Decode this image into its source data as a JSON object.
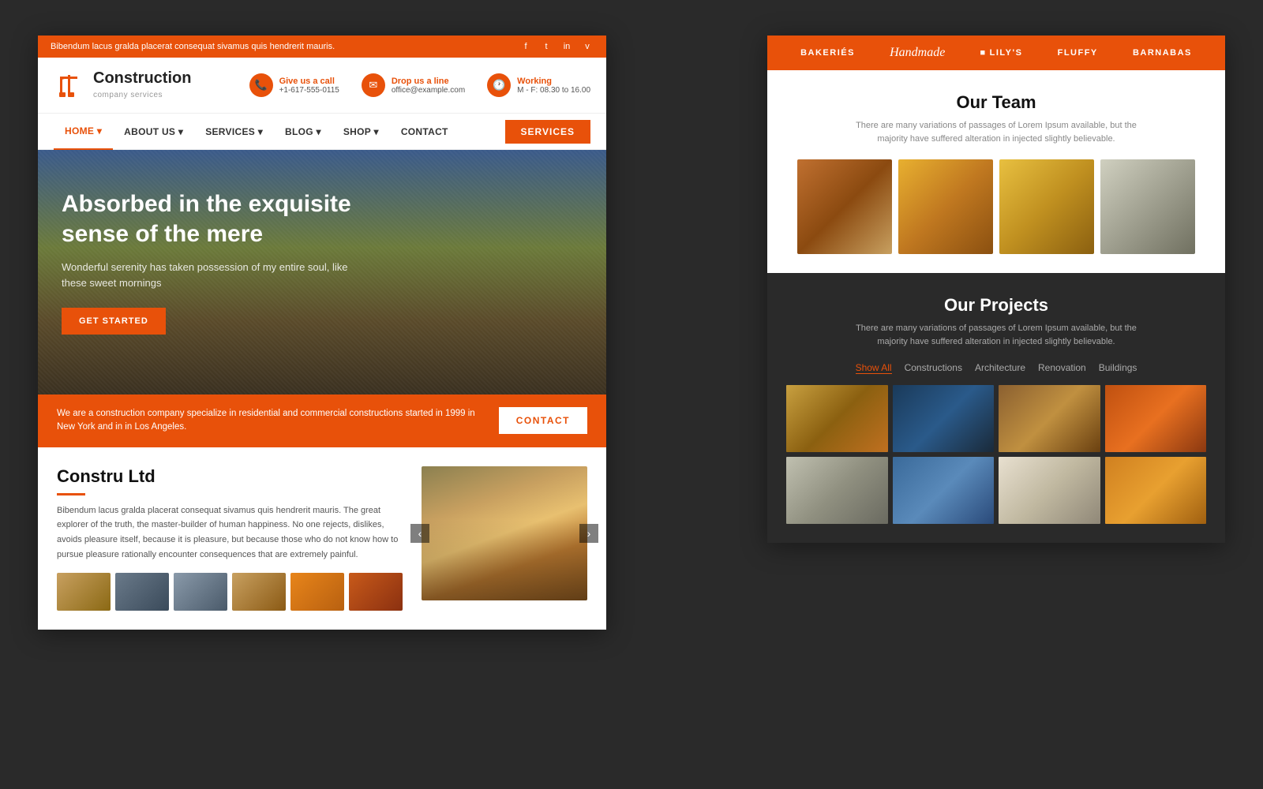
{
  "topbar": {
    "message": "Bibendum lacus gralda placerat consequat sivamus quis hendrerit mauris.",
    "social": [
      "f",
      "t",
      "in",
      "v"
    ]
  },
  "header": {
    "logo_company": "Construction",
    "logo_subtitle": "company services",
    "call_label": "Give us a call",
    "call_number": "+1-617-555-0115",
    "email_label": "Drop us a line",
    "email_address": "office@example.com",
    "hours_label": "Working",
    "hours_value": "M - F: 08.30 to 16.00"
  },
  "nav": {
    "items": [
      "HOME",
      "ABOUT US",
      "SERVICES",
      "BLOG",
      "SHOP",
      "CONTACT"
    ],
    "cta": "SERVICES"
  },
  "hero": {
    "title": "Absorbed in the exquisite sense of the mere",
    "subtitle": "Wonderful serenity has taken possession of my entire soul, like these sweet mornings",
    "cta": "GET STARTED"
  },
  "cta_banner": {
    "text": "We are a construction company specialize in residential and commercial constructions  started in 1999 in New York and in in Los Angeles.",
    "button": "CONTACT"
  },
  "about": {
    "title": "Constru Ltd",
    "description": "Bibendum lacus gralda placerat consequat sivamus quis hendrerit mauris. The great explorer of the truth, the master-builder of human happiness. No one rejects, dislikes, avoids pleasure itself, because it is pleasure, but because those who do not know how to pursue pleasure rationally encounter consequences that are extremely painful."
  },
  "right_panel": {
    "categories": [
      "BAKERIÉS",
      "Handmade",
      "LILY'S",
      "FLUFFY",
      "BARNABAS"
    ],
    "team": {
      "title": "Our Team",
      "subtitle": "There are many variations of passages of Lorem Ipsum available, but the majority have suffered alteration in injected slightly believable.",
      "photos": [
        "worker-planning",
        "workers-machinery",
        "forklift-operator",
        "worker-tools"
      ]
    },
    "projects": {
      "title": "Our Projects",
      "subtitle": "There are many variations of passages of Lorem Ipsum available, but the majority have suffered alteration in injected slightly believable.",
      "filters": [
        "Show All",
        "Constructions",
        "Architecture",
        "Renovation",
        "Buildings"
      ],
      "images": [
        "excavator-ground",
        "tractor-field",
        "lumber-pile",
        "excavator-sky",
        "building-facade",
        "trucks-site",
        "crane-white",
        "backhoe-loader"
      ]
    }
  }
}
